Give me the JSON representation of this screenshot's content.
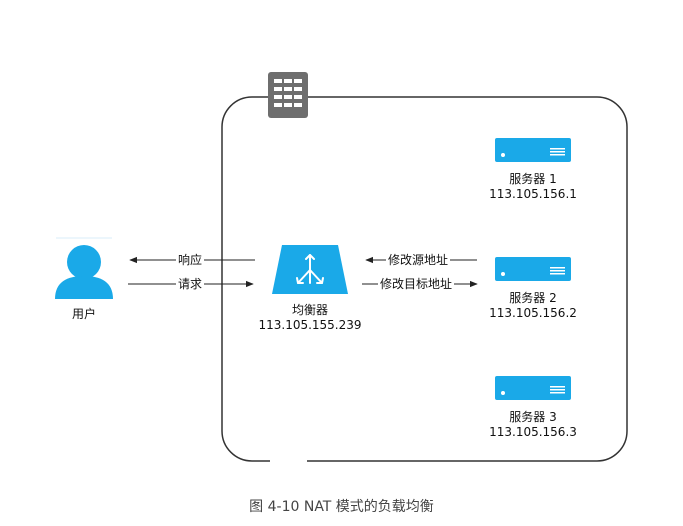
{
  "user": {
    "label": "用户"
  },
  "arrows": {
    "response": "响应",
    "request": "请求",
    "modify_source": "修改源地址",
    "modify_dest": "修改目标地址"
  },
  "balancer": {
    "name": "均衡器",
    "ip": "113.105.155.239"
  },
  "servers": [
    {
      "name": "服务器 1",
      "ip": "113.105.156.1"
    },
    {
      "name": "服务器 2",
      "ip": "113.105.156.2"
    },
    {
      "name": "服务器 3",
      "ip": "113.105.156.3"
    }
  ],
  "caption": "图 4-10 NAT 模式的负载均衡",
  "colors": {
    "accent": "#1aa9e8",
    "frame": "#333333",
    "datacenter": "#6e6e6e"
  },
  "icons": {
    "user": "user-icon",
    "balancer": "load-balancer-icon",
    "server": "server-icon",
    "datacenter": "datacenter-icon"
  }
}
